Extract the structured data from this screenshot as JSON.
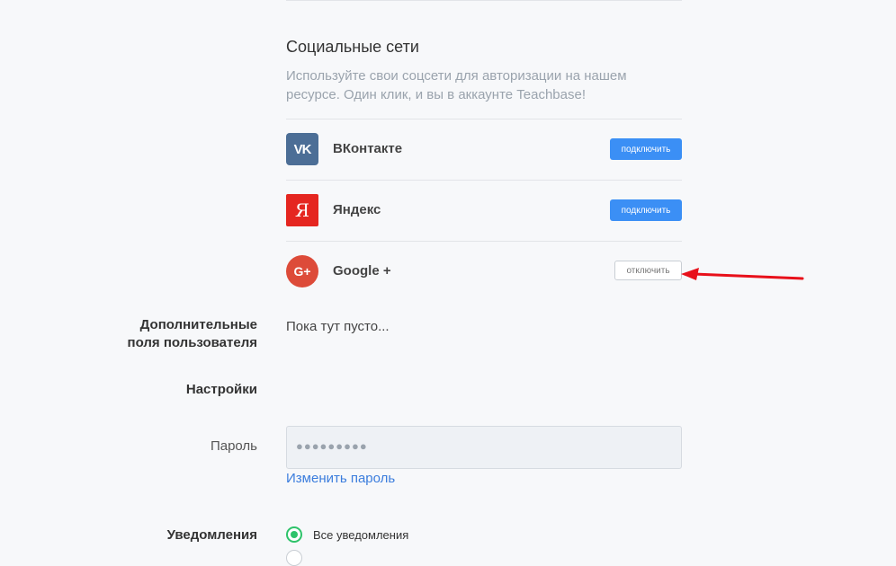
{
  "social": {
    "title": "Социальные сети",
    "description": "Используйте свои соцсети для авторизации на нашем ресурсе. Один клик, и вы в аккаунте Teachbase!",
    "providers": [
      {
        "name": "ВКонтакте",
        "logo": "VK",
        "icon": "vk-icon",
        "color": "#4c6e96",
        "action": "подключить"
      },
      {
        "name": "Яндекс",
        "logo": "Я",
        "icon": "yandex-icon",
        "color": "#e52620",
        "action": "подключить"
      },
      {
        "name": "Google +",
        "logo": "G+",
        "icon": "google-plus-icon",
        "color": "#dd4b39",
        "action": "отключить"
      }
    ]
  },
  "extra_fields": {
    "label": "Дополнительные поля пользователя",
    "empty_text": "Пока тут пусто..."
  },
  "settings": {
    "label": "Настройки",
    "password_label": "Пароль",
    "password_mask": "●●●●●●●●●",
    "change_password": "Изменить пароль"
  },
  "notifications": {
    "label": "Уведомления",
    "options": [
      {
        "label": "Все уведомления",
        "selected": true
      }
    ]
  },
  "colors": {
    "accent": "#3b8ff5",
    "link": "#3b7ddd",
    "radio_selected": "#2ec36a",
    "annotation_arrow": "#e8101a"
  }
}
